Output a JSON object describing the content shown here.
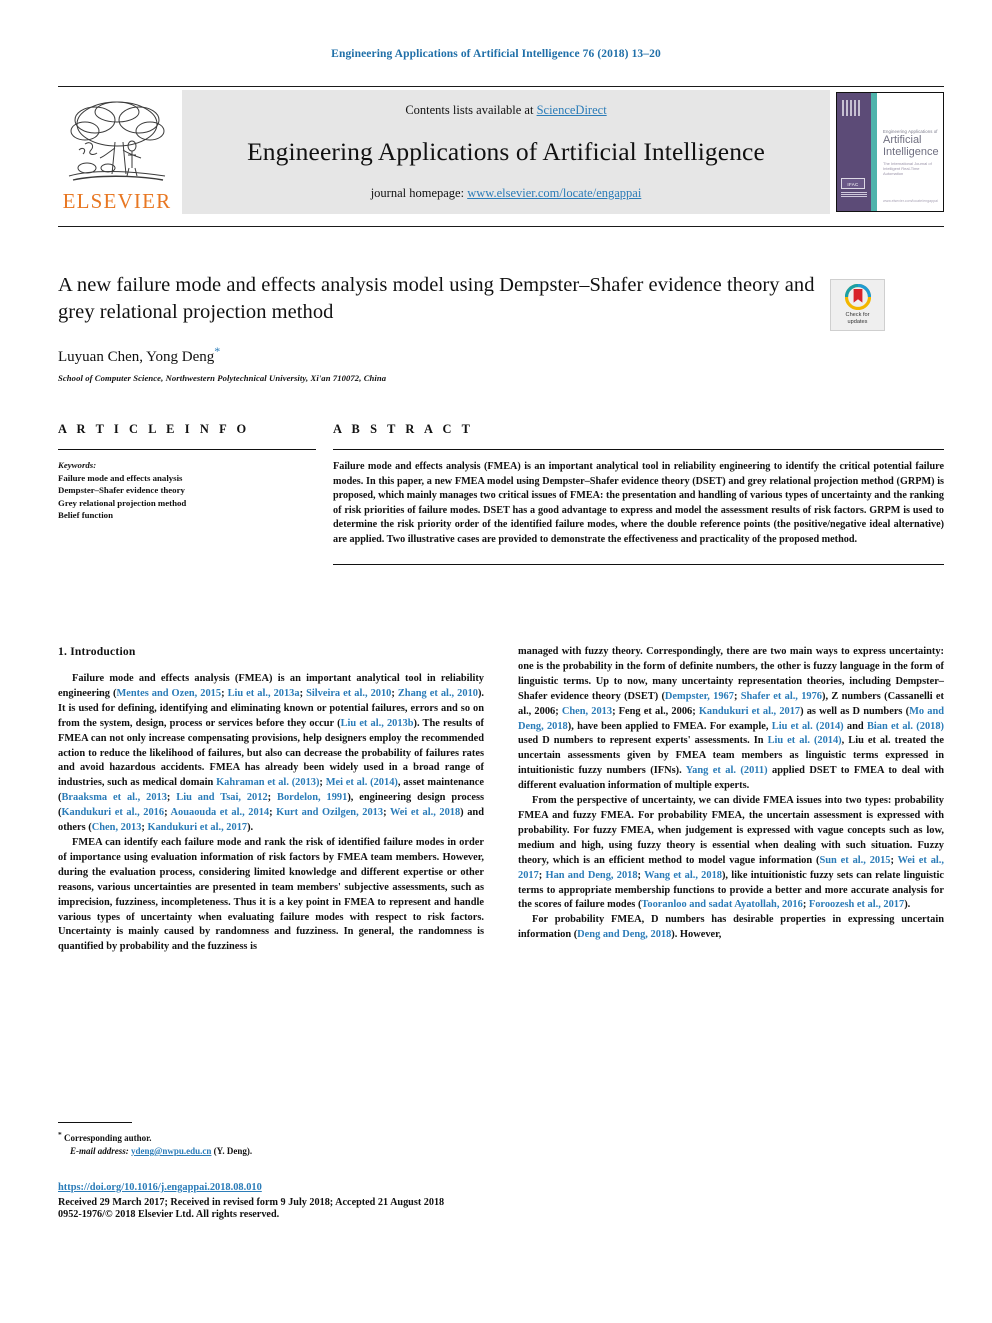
{
  "running_head": "Engineering Applications of Artificial Intelligence 76 (2018) 13–20",
  "masthead": {
    "contents_prefix": "Contents lists available at ",
    "contents_link": "ScienceDirect",
    "journal_title": "Engineering Applications of Artificial Intelligence",
    "homepage_prefix": "journal homepage: ",
    "homepage_link": "www.elsevier.com/locate/engappai",
    "publisher_wordmark": "ELSEVIER",
    "publisher_logo_icon": "elsevier-tree-logo"
  },
  "cover": {
    "kicker": "Engineering Applications of",
    "main_line_1": "Artificial",
    "main_line_2": "Intelligence",
    "tagline": "The International Journal of Intelligent Real-Time Automation",
    "society_mark": "IFAC",
    "footer": "www.elsevier.com/locate/engappai"
  },
  "title": "A new failure mode and effects analysis model using Dempster–Shafer evidence theory and grey relational projection method",
  "authors": "Luyuan Chen, Yong Deng",
  "corresponding_marker": "*",
  "affiliation": "School of Computer Science, Northwestern Polytechnical University, Xi'an 710072, China",
  "crossmark": {
    "icon": "check-for-updates-icon",
    "line1": "Check for",
    "line2": "updates"
  },
  "article_info": {
    "heading": "A R T I C L E   I N F O",
    "keywords_heading": "Keywords:",
    "keywords": [
      "Failure mode and effects analysis",
      "Dempster–Shafer evidence theory",
      "Grey relational projection method",
      "Belief function"
    ]
  },
  "abstract": {
    "heading": "A B S T R A C T",
    "text": "Failure mode and effects analysis (FMEA) is an important analytical tool in reliability engineering to identify the critical potential failure modes. In this paper, a new FMEA model using Dempster–Shafer evidence theory (DSET) and grey relational projection method (GRPM) is proposed, which mainly manages two critical issues of FMEA: the presentation and handling of various types of uncertainty and the ranking of risk priorities of failure modes. DSET has a good advantage to express and model the assessment results of risk factors. GRPM is used to determine the risk priority order of the identified failure modes, where the double reference points (the positive/negative ideal alternative) are applied. Two illustrative cases are provided to demonstrate the effectiveness and practicality of the proposed method."
  },
  "body": {
    "section_heading": "1.  Introduction",
    "left_paragraphs": [
      {
        "runs": [
          {
            "t": "Failure mode and effects analysis (FMEA) is an important analytical tool in reliability engineering ("
          },
          {
            "t": "Mentes and Ozen, 2015",
            "cite": true
          },
          {
            "t": "; "
          },
          {
            "t": "Liu et al., 2013a",
            "cite": true
          },
          {
            "t": "; "
          },
          {
            "t": "Silveira et al., 2010",
            "cite": true
          },
          {
            "t": "; "
          },
          {
            "t": "Zhang et al., 2010",
            "cite": true
          },
          {
            "t": "). It is used for defining, identifying and eliminating known or potential failures, errors and so on from the system, design, process or services before they occur ("
          },
          {
            "t": "Liu et al., 2013b",
            "cite": true
          },
          {
            "t": "). The results of FMEA can not only increase compensating provisions, help designers employ the recommended action to reduce the likelihood of failures, but also can decrease the probability of failures rates and avoid hazardous accidents. FMEA has already been widely used in a broad range of industries, such as medical domain "
          },
          {
            "t": "Kahraman et al. (2013)",
            "cite": true
          },
          {
            "t": "; "
          },
          {
            "t": "Mei et al. (2014)",
            "cite": true
          },
          {
            "t": ", asset maintenance ("
          },
          {
            "t": "Braaksma et al., 2013",
            "cite": true
          },
          {
            "t": "; "
          },
          {
            "t": "Liu and Tsai, 2012",
            "cite": true
          },
          {
            "t": "; "
          },
          {
            "t": "Bordelon, 1991",
            "cite": true
          },
          {
            "t": "), engineering design process ("
          },
          {
            "t": "Kandukuri et al., 2016",
            "cite": true
          },
          {
            "t": "; "
          },
          {
            "t": "Aouaouda et al., 2014",
            "cite": true
          },
          {
            "t": "; "
          },
          {
            "t": "Kurt and Ozilgen, 2013",
            "cite": true
          },
          {
            "t": "; "
          },
          {
            "t": "Wei et al., 2018",
            "cite": true
          },
          {
            "t": ") and others ("
          },
          {
            "t": "Chen, 2013",
            "cite": true
          },
          {
            "t": "; "
          },
          {
            "t": "Kandukuri et al., 2017",
            "cite": true
          },
          {
            "t": ")."
          }
        ]
      },
      {
        "runs": [
          {
            "t": "FMEA can identify each failure mode and rank the risk of identified failure modes in order of importance using evaluation information of risk factors by FMEA team members. However, during the evaluation process, considering limited knowledge and different expertise or other reasons, various uncertainties are presented in team members' subjective assessments, such as imprecision, fuzziness, incompleteness. Thus it is a key point in FMEA to represent and handle various types of uncertainty when evaluating failure modes with respect to risk factors. Uncertainty is mainly caused by randomness and fuzziness. In general, the randomness is quantified by probability and the fuzziness is"
          }
        ]
      }
    ],
    "right_paragraphs": [
      {
        "runs": [
          {
            "t": "managed with fuzzy theory. Correspondingly, there are two main ways to express uncertainty: one is the probability in the form of definite numbers, the other is fuzzy language in the form of linguistic terms. Up to now, many uncertainty representation theories, including Dempster–Shafer evidence theory (DSET) ("
          },
          {
            "t": "Dempster, 1967",
            "cite": true
          },
          {
            "t": "; "
          },
          {
            "t": "Shafer et al., 1976",
            "cite": true
          },
          {
            "t": "), Z numbers (Cassanelli et al., 2006; "
          },
          {
            "t": "Chen, 2013",
            "cite": true
          },
          {
            "t": "; Feng et al., 2006; "
          },
          {
            "t": "Kandukuri et al., 2017",
            "cite": true
          },
          {
            "t": ") as well as D numbers ("
          },
          {
            "t": "Mo and Deng, 2018",
            "cite": true
          },
          {
            "t": "), have been applied to FMEA. For example, "
          },
          {
            "t": "Liu et al. (2014)",
            "cite": true
          },
          {
            "t": " and "
          },
          {
            "t": "Bian et al. (2018)",
            "cite": true
          },
          {
            "t": " used D numbers to represent experts' assessments. In "
          },
          {
            "t": "Liu et al. (2014)",
            "cite": true
          },
          {
            "t": ", Liu et al. treated the uncertain assessments given by FMEA team members as linguistic terms expressed in intuitionistic fuzzy numbers (IFNs). "
          },
          {
            "t": "Yang et al. (2011)",
            "cite": true
          },
          {
            "t": " applied DSET to FMEA to deal with different evaluation information of multiple experts."
          }
        ]
      },
      {
        "runs": [
          {
            "t": "From the perspective of uncertainty, we can divide FMEA issues into two types: probability FMEA and fuzzy FMEA. For probability FMEA, the uncertain assessment is expressed with probability. For fuzzy FMEA, when judgement is expressed with vague concepts such as low, medium and high, using fuzzy theory is essential when dealing with such situation. Fuzzy theory, which is an efficient method to model vague information ("
          },
          {
            "t": "Sun et al., 2015",
            "cite": true
          },
          {
            "t": "; "
          },
          {
            "t": "Wei et al., 2017",
            "cite": true
          },
          {
            "t": "; "
          },
          {
            "t": "Han and Deng, 2018",
            "cite": true
          },
          {
            "t": "; "
          },
          {
            "t": "Wang et al., 2018",
            "cite": true
          },
          {
            "t": "), like intuitionistic fuzzy sets can relate linguistic terms to appropriate membership functions to provide a better and more accurate analysis for the scores of failure modes ("
          },
          {
            "t": "Tooranloo and sadat Ayatollah, 2016",
            "cite": true
          },
          {
            "t": "; "
          },
          {
            "t": "Foroozesh et al., 2017",
            "cite": true
          },
          {
            "t": ")."
          }
        ]
      },
      {
        "runs": [
          {
            "t": "For probability FMEA, D numbers has desirable properties in expressing uncertain information ("
          },
          {
            "t": "Deng and Deng, 2018",
            "cite": true
          },
          {
            "t": "). However,"
          }
        ]
      }
    ]
  },
  "footnote": {
    "marker": "*",
    "corresponding": "Corresponding author.",
    "email_label": "E-mail address:",
    "email": "ydeng@nwpu.edu.cn",
    "email_suffix": "(Y. Deng)."
  },
  "footer": {
    "doi": "https://doi.org/10.1016/j.engappai.2018.08.010",
    "received": "Received 29 March 2017; Received in revised form 9 July 2018; Accepted 21 August 2018",
    "issn": "0952-1976/© 2018 Elsevier Ltd. All rights reserved."
  },
  "colors": {
    "link": "#2b7cb8",
    "running_head": "#1f6fa8",
    "elsevier_orange": "#E87722",
    "masthead_bg": "#e6e6e6",
    "cover_purple": "#5c4b77",
    "cover_teal": "#4fb3ab"
  }
}
